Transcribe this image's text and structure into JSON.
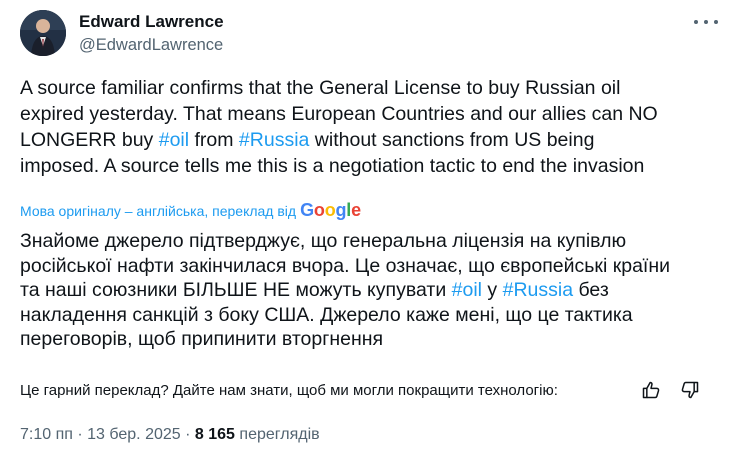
{
  "author": {
    "name": "Edward Lawrence",
    "handle": "@EdwardLawrence"
  },
  "tweet": {
    "text_lines": [
      "A source familiar confirms that the General License to buy Russian oil",
      "expired yesterday. That means European Countries and our allies can NO",
      "LONGERR buy ",
      "#oil",
      " from ",
      "#Russia",
      " without sanctions from US being",
      "imposed. A source tells me this is a negotiation tactic to end the invasion"
    ]
  },
  "translation": {
    "attribution": "Мова оригіналу – англійська, переклад від",
    "provider": "Google",
    "text_parts": [
      "Знайоме джерело підтверджує, що генеральна ліцензія на купівлю",
      "російської нафти закінчилася вчора. Це означає, що європейські країни",
      "та наші союзники БІЛЬШЕ НЕ можуть купувати ",
      "#oil",
      " у ",
      "#Russia",
      " без",
      "накладення санкцій з боку США. Джерело каже мені, що це тактика",
      "переговорів, щоб припинити вторгнення"
    ],
    "feedback_prompt": "Це гарний переклад? Дайте нам знати, щоб ми могли покращити технологію:"
  },
  "meta": {
    "time": "7:10 пп",
    "separator": "·",
    "date": "13 бер. 2025",
    "views_count": "8 165",
    "views_label": "переглядів"
  },
  "colors": {
    "accent": "#1d9bf0",
    "secondary_text": "#536471"
  }
}
